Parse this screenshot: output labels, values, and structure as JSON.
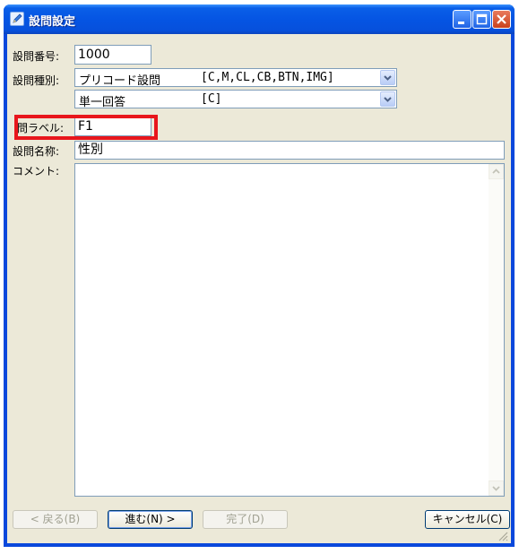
{
  "window": {
    "title": "設問設定",
    "icon": "edit-pencil-icon",
    "controls": [
      "minimize-icon",
      "maximize-icon",
      "close-icon"
    ]
  },
  "form": {
    "question_number": {
      "label": "設問番号:",
      "value": "1000"
    },
    "question_type": {
      "label": "設問種別:",
      "selected": "プリコード設問",
      "codes": "[C,M,CL,CB,BTN,IMG]"
    },
    "answer_type": {
      "selected": "単一回答",
      "codes": "[C]"
    },
    "question_label": {
      "label": "問ラベル:",
      "value": "F1"
    },
    "question_name": {
      "label": "設問名称:",
      "value": "性別"
    },
    "comment": {
      "label": "コメント:",
      "value": ""
    }
  },
  "buttons": {
    "back": "< 戻る(B)",
    "next": "進む(N) >",
    "finish": "完了(D)",
    "cancel": "キャンセル(C)"
  },
  "colors": {
    "titlebar": "#0555e3",
    "client": "#ece9d8",
    "highlight": "#e8161c",
    "field_border": "#7f9db9"
  }
}
